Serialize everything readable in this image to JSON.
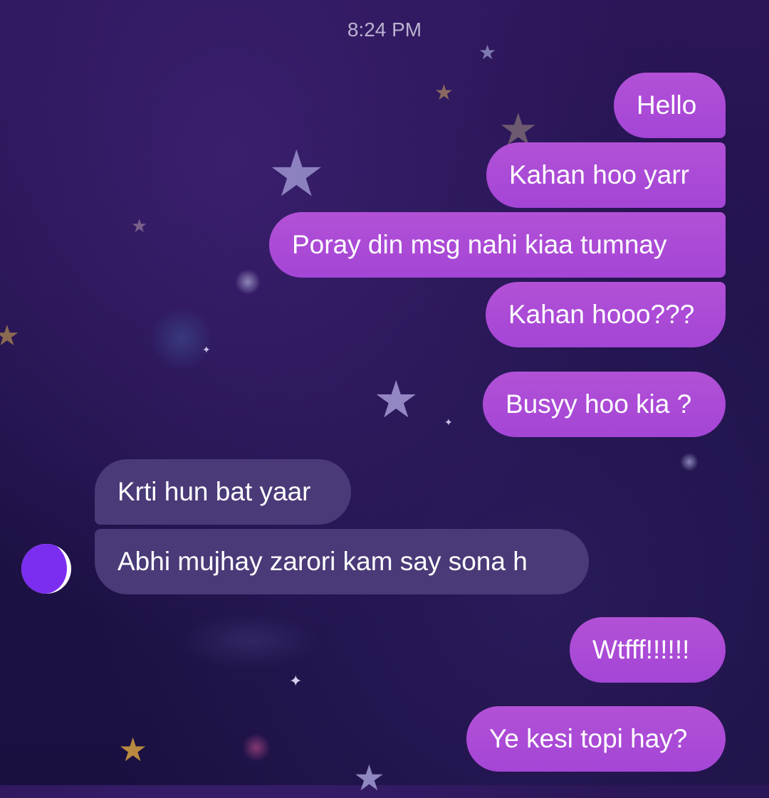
{
  "chat": {
    "timestamp": "8:24 PM",
    "messages": [
      {
        "sender": "me",
        "text": "Hello"
      },
      {
        "sender": "me",
        "text": "Kahan hoo yarr"
      },
      {
        "sender": "me",
        "text": "Poray din msg nahi kiaa tumnay"
      },
      {
        "sender": "me",
        "text": "Kahan hooo???"
      },
      {
        "sender": "me",
        "text": "Busyy hoo kia ?"
      },
      {
        "sender": "contact",
        "text": "Krti hun bat yaar"
      },
      {
        "sender": "contact",
        "text": "Abhi mujhay zarori kam say sona h"
      },
      {
        "sender": "me",
        "text": "Wtfff!!!!!!"
      },
      {
        "sender": "me",
        "text": "Ye kesi topi hay?"
      }
    ]
  },
  "colors": {
    "outgoing_bubble": "#a445d6",
    "incoming_bubble": "#4a3a78",
    "background": "#1f1248"
  },
  "icons": {
    "avatar": "contact-avatar-scribbled",
    "background_decor": "star-icon"
  }
}
